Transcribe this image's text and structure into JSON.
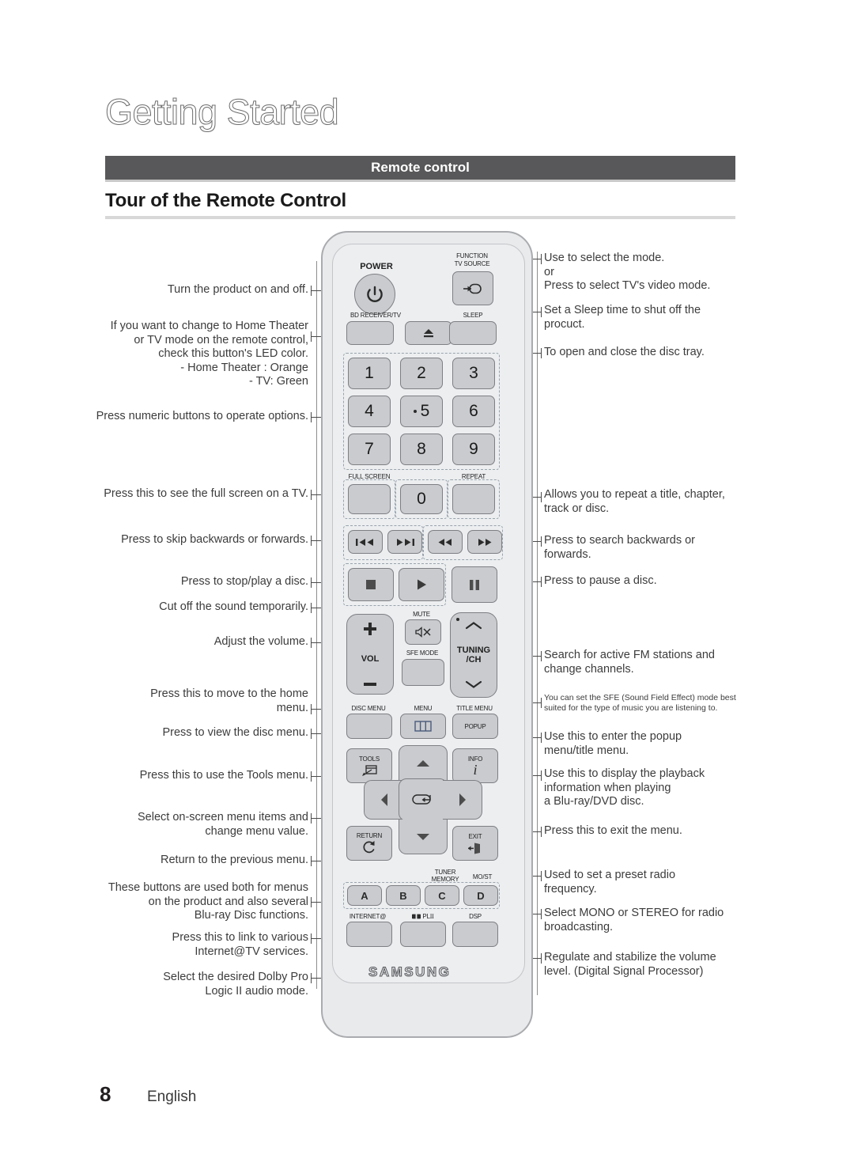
{
  "header": {
    "title": "Getting Started",
    "section_bar": "Remote control",
    "subtitle": "Tour of the Remote Control"
  },
  "footer": {
    "page_number": "8",
    "language": "English"
  },
  "callouts_left": [
    {
      "id": "power",
      "text": "Turn the product on and off."
    },
    {
      "id": "bd-receiver",
      "text": "If you want to change to Home Theater\nor TV mode on the remote control,\ncheck this button's LED color.\n- Home Theater : Orange\n- TV: Green"
    },
    {
      "id": "numeric",
      "text": "Press numeric buttons to operate options."
    },
    {
      "id": "full-screen",
      "text": "Press this to see the full screen on a TV."
    },
    {
      "id": "skip",
      "text": "Press to skip backwards or forwards."
    },
    {
      "id": "stop-play",
      "text": "Press to stop/play a disc."
    },
    {
      "id": "mute",
      "text": "Cut off the sound temporarily."
    },
    {
      "id": "volume",
      "text": "Adjust the volume."
    },
    {
      "id": "home-menu",
      "text": "Press this to move to the home\nmenu."
    },
    {
      "id": "disc-menu",
      "text": "Press to view the disc menu."
    },
    {
      "id": "tools",
      "text": "Press this to use the Tools menu."
    },
    {
      "id": "dpad",
      "text": "Select on-screen menu items and\nchange menu value."
    },
    {
      "id": "return",
      "text": "Return to the previous menu."
    },
    {
      "id": "color-keys",
      "text": "These buttons are used both for menus\non the product and also several\nBlu-ray Disc functions."
    },
    {
      "id": "internet",
      "text": "Press this to link to various\nInternet@TV services."
    },
    {
      "id": "dolby",
      "text": "Select the desired Dolby Pro\nLogic II  audio mode."
    }
  ],
  "callouts_right": [
    {
      "id": "function",
      "text": "Use to select the mode.\nor\nPress to select TV's video mode."
    },
    {
      "id": "sleep",
      "text": "Set a Sleep time to shut off the\nprocuct."
    },
    {
      "id": "eject",
      "text": "To open and close the disc tray."
    },
    {
      "id": "repeat",
      "text": "Allows you to repeat a title, chapter,\ntrack or disc."
    },
    {
      "id": "search",
      "text": "Press to search backwards or\nforwards."
    },
    {
      "id": "pause",
      "text": "Press to pause a disc."
    },
    {
      "id": "tuning",
      "text": "Search for active FM stations and\nchange channels."
    },
    {
      "id": "sfe-mode",
      "text": "You can set the SFE (Sound Field Effect) mode best\nsuited for the type of music you are listening to."
    },
    {
      "id": "popup",
      "text": "Use this to enter the popup\nmenu/title menu."
    },
    {
      "id": "info",
      "text": "Use this to display the playback\ninformation when playing\na Blu-ray/DVD disc."
    },
    {
      "id": "exit",
      "text": "Press this to exit the menu."
    },
    {
      "id": "tuner-mem",
      "text": "Used to set a preset radio\nfrequency."
    },
    {
      "id": "mo-st",
      "text": "Select MONO or STEREO for radio\nbroadcasting."
    },
    {
      "id": "dsp",
      "text": "Regulate and stabilize the volume\nlevel. (Digital Signal Processor)"
    }
  ],
  "remote": {
    "brand": "SAMSUNG",
    "labels": {
      "power": "POWER",
      "function": "FUNCTION",
      "tv_source": "TV SOURCE",
      "bd_receiver_tv": "BD RECEIVER/TV",
      "sleep": "SLEEP",
      "full_screen": "FULL SCREEN",
      "repeat": "REPEAT",
      "mute": "MUTE",
      "vol": "VOL",
      "sfe_mode": "SFE MODE",
      "tuning_ch_1": "TUNING",
      "tuning_ch_2": "/CH",
      "disc_menu": "DISC MENU",
      "menu": "MENU",
      "title_menu": "TITLE MENU",
      "popup": "POPUP",
      "tools": "TOOLS",
      "info": "INFO",
      "info_glyph": "i",
      "return": "RETURN",
      "exit": "EXIT",
      "tuner_memory_1": "TUNER",
      "tuner_memory_2": "MEMORY",
      "mo_st": "MO/ST",
      "internet": "INTERNET@",
      "dolby_pl": "PL",
      "dolby_pl_suffix": "II",
      "dsp": "DSP"
    },
    "numeric_keys": [
      "1",
      "2",
      "3",
      "4",
      "5",
      "6",
      "7",
      "8",
      "9",
      "0"
    ],
    "color_keys": [
      "A",
      "B",
      "C",
      "D"
    ]
  },
  "colors": {
    "section_bar": "#58585a",
    "button_face": "#c9cbce",
    "remote_body": "#e9eaec",
    "text": "#3c3c3c"
  }
}
